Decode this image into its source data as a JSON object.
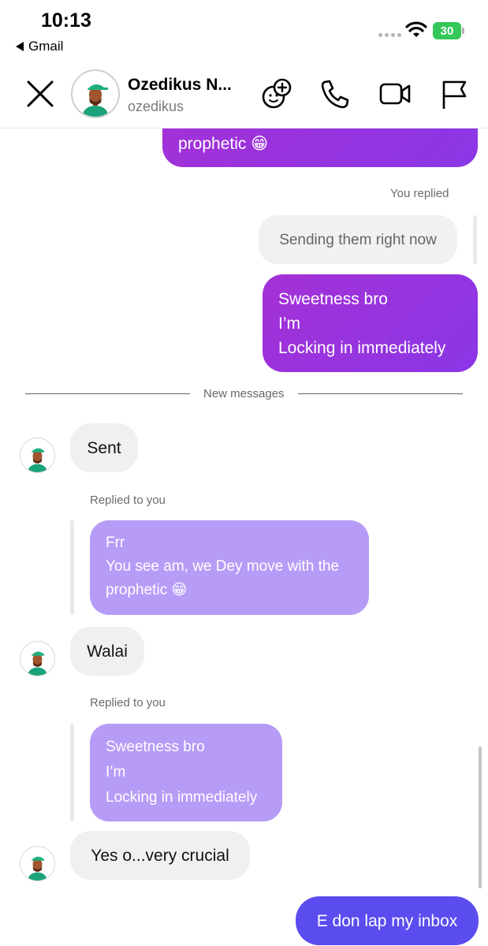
{
  "status_bar": {
    "time": "10:13",
    "back_app": "Gmail",
    "battery": "30"
  },
  "header": {
    "name": "Ozedikus N...",
    "handle": "ozedikus"
  },
  "messages": {
    "prev_out_tail": "prophetic 😁",
    "you_replied_label": "You replied",
    "reply_ghost_text": "Sending them right now",
    "out_1": [
      "Sweetness bro",
      "I’m",
      "Locking in immediately"
    ],
    "new_messages_label": "New messages",
    "in_sent": "Sent",
    "replied_to_you_1": "Replied to you",
    "quote_1": [
      "Frr",
      "You see am, we Dey move with the",
      "prophetic 😁"
    ],
    "in_walai": "Walai",
    "replied_to_you_2": "Replied to you",
    "quote_2": [
      "Sweetness bro",
      "I’m",
      "Locking in immediately"
    ],
    "in_yes": "Yes o...very crucial",
    "out_last": "E don lap my inbox"
  },
  "colors": {
    "outgoing_gradient_start": "#a531d6",
    "outgoing_gradient_end": "#8a36e6",
    "quote_bubble": "#b69cf7",
    "latest_outgoing": "#5b4cf0",
    "incoming_bubble": "#eff0f2",
    "battery_green": "#34c759"
  },
  "icons": {
    "close": "close-icon",
    "add_person": "add-friend-icon",
    "call": "phone-icon",
    "video": "video-icon",
    "report": "flag-icon"
  }
}
